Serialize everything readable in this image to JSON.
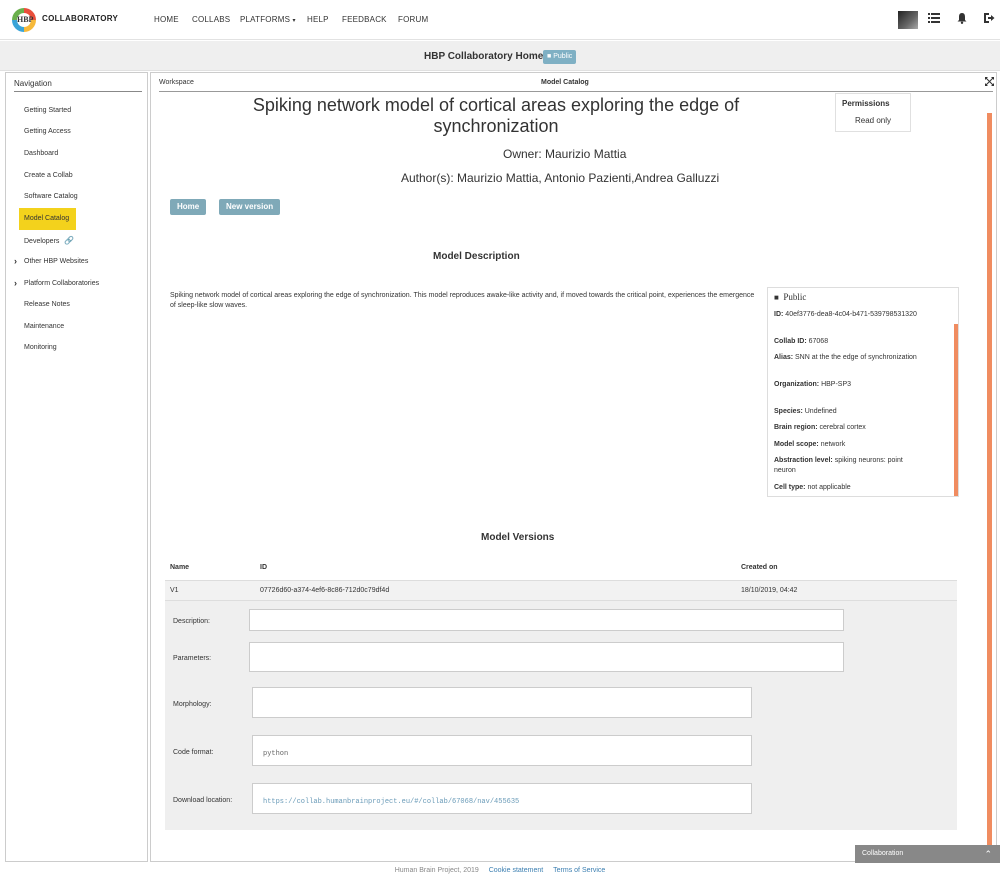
{
  "topnav": {
    "brand": "COLLABORATORY",
    "logo_text": "HBP",
    "items": [
      "HOME",
      "COLLABS",
      "PLATFORMS",
      "HELP",
      "FEEDBACK",
      "FORUM"
    ]
  },
  "subheader": {
    "title": "HBP Collaboratory Home",
    "badge": "Public"
  },
  "navigation": {
    "title": "Navigation",
    "items": [
      {
        "label": "Getting Started"
      },
      {
        "label": "Getting Access"
      },
      {
        "label": "Dashboard"
      },
      {
        "label": "Create a Collab"
      },
      {
        "label": "Software Catalog"
      },
      {
        "label": "Model Catalog"
      },
      {
        "label": "Developers"
      },
      {
        "label": "Other HBP Websites"
      },
      {
        "label": "Platform Collaboratories"
      },
      {
        "label": "Release Notes"
      },
      {
        "label": "Maintenance"
      },
      {
        "label": "Monitoring"
      }
    ]
  },
  "workspace": {
    "label": "Workspace",
    "title": "Model Catalog"
  },
  "model": {
    "title": "Spiking network model of cortical areas exploring the edge of synchronization",
    "owner": "Owner: Maurizio Mattia",
    "authors": "Author(s): Maurizio Mattia, Antonio Pazienti,Andrea Galluzzi",
    "permissions_label": "Permissions",
    "permissions_value": "Read only",
    "buttons": {
      "home": "Home",
      "new_version": "New version"
    },
    "description_heading": "Model Description",
    "description": "Spiking network model of cortical areas exploring the edge of synchronization. This model reproduces awake-like activity and, if moved towards the critical point, experiences the emergence of sleep-like slow waves.",
    "info": {
      "visibility": "Public",
      "id_label": "ID:",
      "id": "40ef3776-dea8-4c04-b471-539798531320",
      "collab_label": "Collab ID:",
      "collab": "67068",
      "alias_label": "Alias:",
      "alias": "SNN at the the edge of synchronization",
      "org_label": "Organization:",
      "org": "HBP-SP3",
      "species_label": "Species:",
      "species": "Undefined",
      "region_label": "Brain region:",
      "region": "cerebral cortex",
      "scope_label": "Model scope:",
      "scope": "network",
      "abstraction_label": "Abstraction level:",
      "abstraction": "spiking neurons: point neuron",
      "cell_label": "Cell type:",
      "cell": "not applicable"
    },
    "versions_heading": "Model Versions",
    "versions_columns": [
      "Name",
      "ID",
      "Created on"
    ],
    "version": {
      "name": "V1",
      "id": "07726d60-a374-4ef6-8c86-712d0c79df4d",
      "created": "18/10/2019, 04:42"
    },
    "detail": {
      "description_label": "Description:",
      "parameters_label": "Parameters:",
      "morphology_label": "Morphology:",
      "code_format_label": "Code format:",
      "code_format": "python",
      "download_label": "Download location:",
      "download": "https://collab.humanbrainproject.eu/#/collab/67068/nav/455635"
    }
  },
  "collaboration_bar": "Collaboration",
  "footer": {
    "copyright": "Human Brain Project, 2019",
    "cookie": "Cookie statement",
    "terms": "Terms of Service"
  }
}
